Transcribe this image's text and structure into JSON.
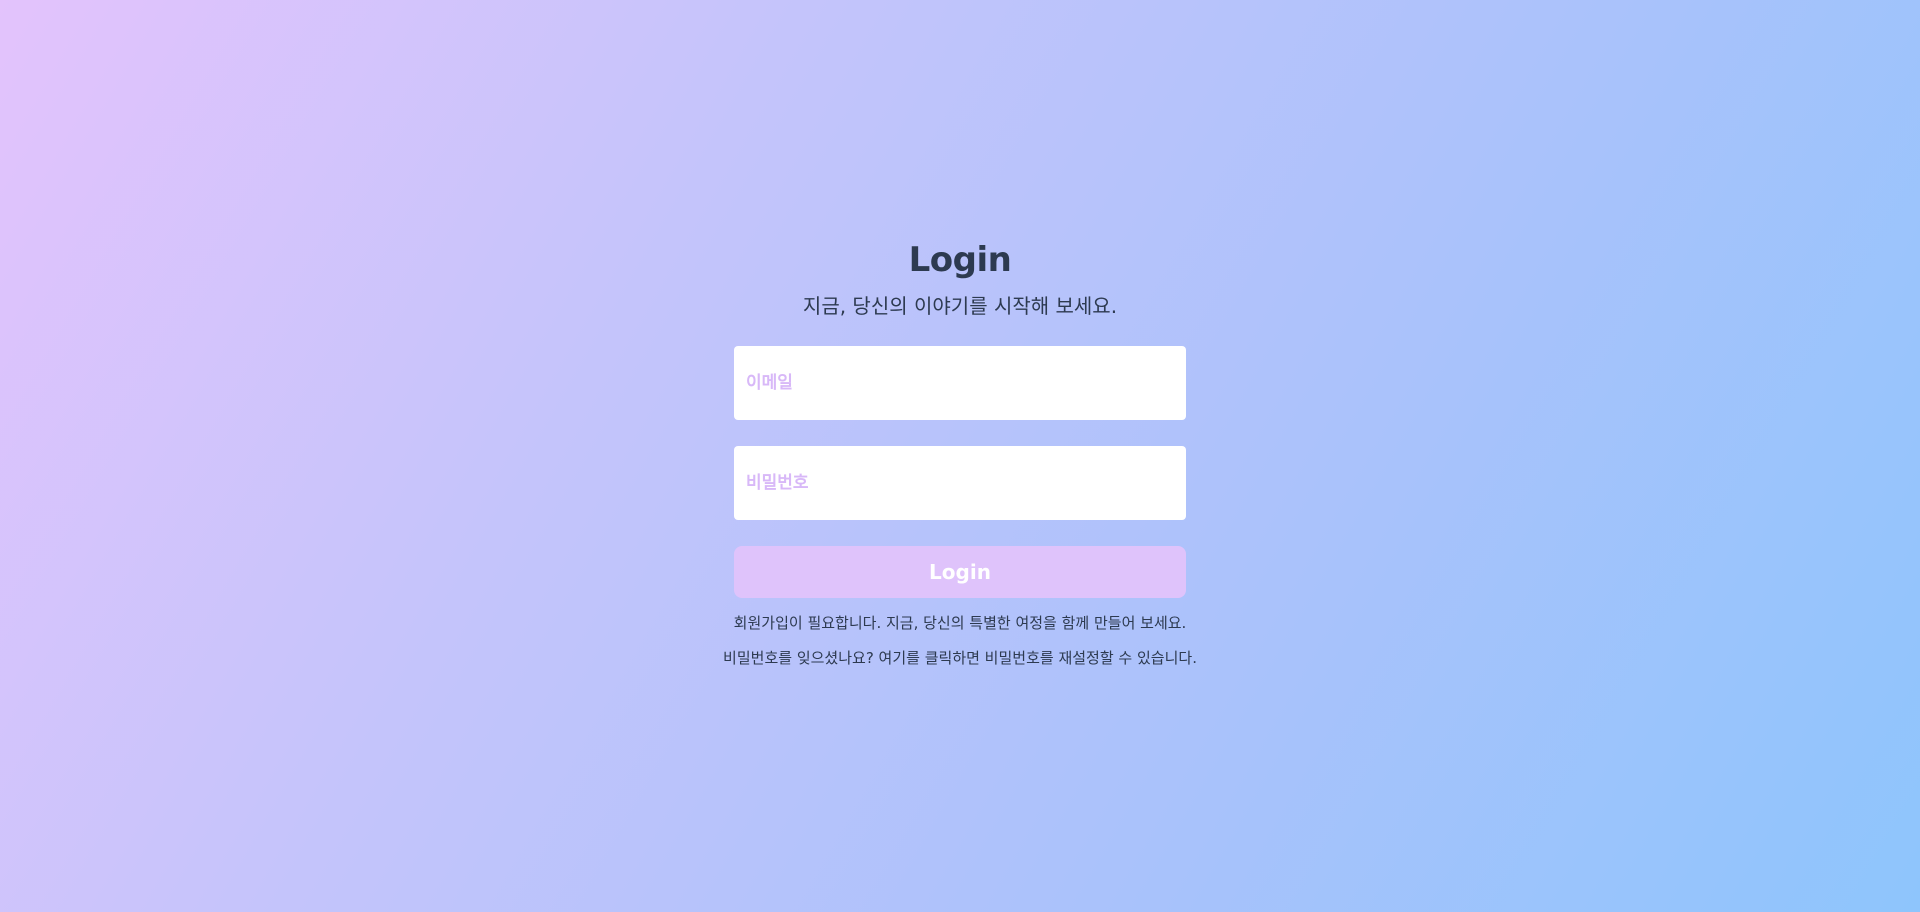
{
  "login": {
    "title": "Login",
    "subtitle": "지금, 당신의 이야기를 시작해 보세요.",
    "email_placeholder": "이메일",
    "password_placeholder": "비밀번호",
    "submit_label": "Login",
    "signup_text": "회원가입이 필요합니다. 지금, 당신의 특별한 여정을 함께 만들어 보세요.",
    "forgot_text": "비밀번호를 잊으셨나요? 여기를 클릭하면 비밀번호를 재설정할 수 있습니다."
  },
  "colors": {
    "gradient_start": "#e3c3fc",
    "gradient_end": "#8ec5fc",
    "text": "#2d3a50",
    "button_bg": "#dfc3fb",
    "placeholder": "#d8b8f8"
  }
}
